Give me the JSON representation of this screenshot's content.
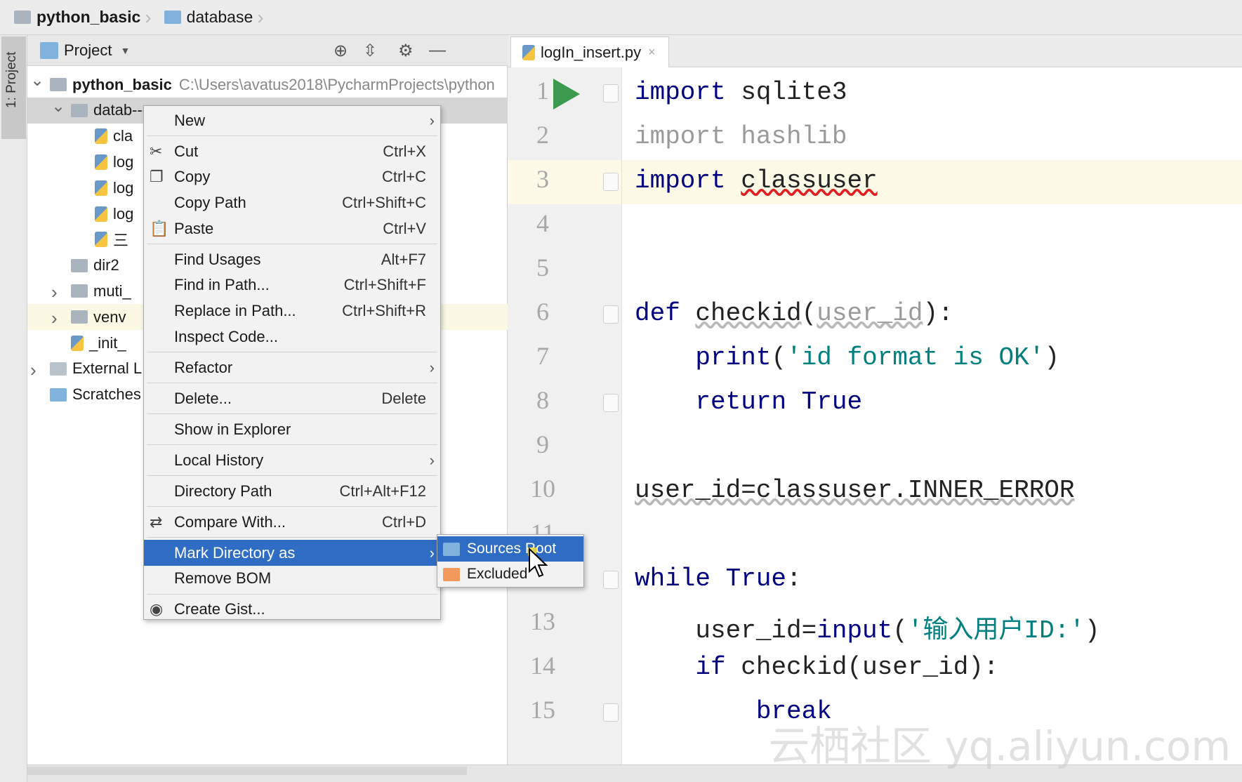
{
  "breadcrumb": [
    {
      "label": "python_basic",
      "icon": "folder-icon"
    },
    {
      "label": "database",
      "icon": "folder-blue-icon"
    }
  ],
  "side_stripe": {
    "label": "1: Project"
  },
  "project_panel": {
    "title": "Project",
    "header_icons": [
      "locate-icon",
      "collapse-all-icon",
      "gear-icon",
      "minimize-icon"
    ],
    "tree": [
      {
        "label": "python_basic",
        "path": "C:\\Users\\avatus2018\\PycharmProjects\\python",
        "level": 0,
        "expanded": true,
        "icon": "folder-icon"
      },
      {
        "label": "datab---",
        "level": 1,
        "expanded": true,
        "selected": true,
        "icon": "folder-icon"
      },
      {
        "label": "cla",
        "level": 2,
        "icon": "python-file-icon"
      },
      {
        "label": "log",
        "level": 2,
        "icon": "python-file-icon"
      },
      {
        "label": "log",
        "level": 2,
        "icon": "python-file-icon"
      },
      {
        "label": "log",
        "level": 2,
        "icon": "python-file-icon"
      },
      {
        "label": "三",
        "level": 2,
        "icon": "python-file-icon"
      },
      {
        "label": "dir2",
        "level": 1,
        "icon": "folder-icon"
      },
      {
        "label": "muti_",
        "level": 1,
        "collapsed": true,
        "icon": "folder-icon"
      },
      {
        "label": "venv",
        "level": 1,
        "collapsed": true,
        "highlight": true,
        "icon": "folder-icon"
      },
      {
        "label": "_init_",
        "level": 1,
        "icon": "python-file-icon"
      },
      {
        "label": "External L",
        "level": 0,
        "collapsed": true,
        "icon": "library-icon"
      },
      {
        "label": "Scratches",
        "level": 0,
        "icon": "scratches-icon"
      }
    ]
  },
  "context_menu": {
    "items": [
      {
        "label": "New",
        "submenu": true
      },
      {
        "sep": true
      },
      {
        "label": "Cut",
        "shortcut": "Ctrl+X",
        "icon": "scissors-icon"
      },
      {
        "label": "Copy",
        "shortcut": "Ctrl+C",
        "icon": "copy-icon"
      },
      {
        "label": "Copy Path",
        "shortcut": "Ctrl+Shift+C"
      },
      {
        "label": "Paste",
        "shortcut": "Ctrl+V",
        "icon": "paste-icon"
      },
      {
        "sep": true
      },
      {
        "label": "Find Usages",
        "shortcut": "Alt+F7"
      },
      {
        "label": "Find in Path...",
        "shortcut": "Ctrl+Shift+F"
      },
      {
        "label": "Replace in Path...",
        "shortcut": "Ctrl+Shift+R"
      },
      {
        "label": "Inspect Code..."
      },
      {
        "sep": true
      },
      {
        "label": "Refactor",
        "submenu": true
      },
      {
        "sep": true
      },
      {
        "label": "Delete...",
        "shortcut": "Delete"
      },
      {
        "sep": true
      },
      {
        "label": "Show in Explorer"
      },
      {
        "sep": true
      },
      {
        "label": "Local History",
        "submenu": true
      },
      {
        "sep": true
      },
      {
        "label": "Directory Path",
        "shortcut": "Ctrl+Alt+F12"
      },
      {
        "sep": true
      },
      {
        "label": "Compare With...",
        "shortcut": "Ctrl+D",
        "icon": "compare-icon"
      },
      {
        "sep": true
      },
      {
        "label": "Mark Directory as",
        "submenu": true,
        "selected": true
      },
      {
        "label": "Remove BOM"
      },
      {
        "sep": true
      },
      {
        "label": "Create Gist...",
        "icon": "github-icon"
      }
    ]
  },
  "submenu": {
    "items": [
      {
        "label": "Sources Root",
        "selected": true,
        "icon": "folder-blue-icon"
      },
      {
        "label": "Excluded",
        "icon": "folder-orange-icon"
      }
    ]
  },
  "editor": {
    "tab": {
      "label": "logIn_insert.py",
      "close": "×"
    },
    "current_line": 3,
    "lines": [
      [
        {
          "t": "import",
          "c": "kw"
        },
        {
          "t": " sqlite3"
        }
      ],
      [
        {
          "t": "import hashlib",
          "c": "dim"
        }
      ],
      [
        {
          "t": "import",
          "c": "kw"
        },
        {
          "t": " "
        },
        {
          "t": "classuser",
          "c": "err"
        }
      ],
      [],
      [],
      [
        {
          "t": "def",
          "c": "kw"
        },
        {
          "t": " "
        },
        {
          "t": "checkid",
          "c": "warn"
        },
        {
          "t": "("
        },
        {
          "t": "user_id",
          "c": "dim warn"
        },
        {
          "t": "):"
        }
      ],
      [
        {
          "t": "    "
        },
        {
          "t": "print",
          "c": "kw"
        },
        {
          "t": "("
        },
        {
          "t": "'id format is OK'",
          "c": "str"
        },
        {
          "t": ")"
        }
      ],
      [
        {
          "t": "    "
        },
        {
          "t": "return True",
          "c": "kw"
        }
      ],
      [],
      [
        {
          "t": "user_id=classuser.INNER_ERROR",
          "c": "warn"
        }
      ],
      [],
      [
        {
          "t": "while True",
          "c": "kw"
        },
        {
          "t": ":"
        }
      ],
      [
        {
          "t": "    user_id="
        },
        {
          "t": "input",
          "c": "kw"
        },
        {
          "t": "("
        },
        {
          "t": "'输入用户ID:'",
          "c": "str"
        },
        {
          "t": ")"
        }
      ],
      [
        {
          "t": "    "
        },
        {
          "t": "if",
          "c": "kw"
        },
        {
          "t": " checkid(user_id):"
        }
      ],
      [
        {
          "t": "        "
        },
        {
          "t": "break",
          "c": "kw"
        }
      ]
    ]
  },
  "watermark": "云栖社区 yq.aliyun.com",
  "colors": {
    "selection": "#2f6cc4",
    "keyword": "#000080",
    "string": "#007f7f",
    "run": "#3c9a4f"
  }
}
